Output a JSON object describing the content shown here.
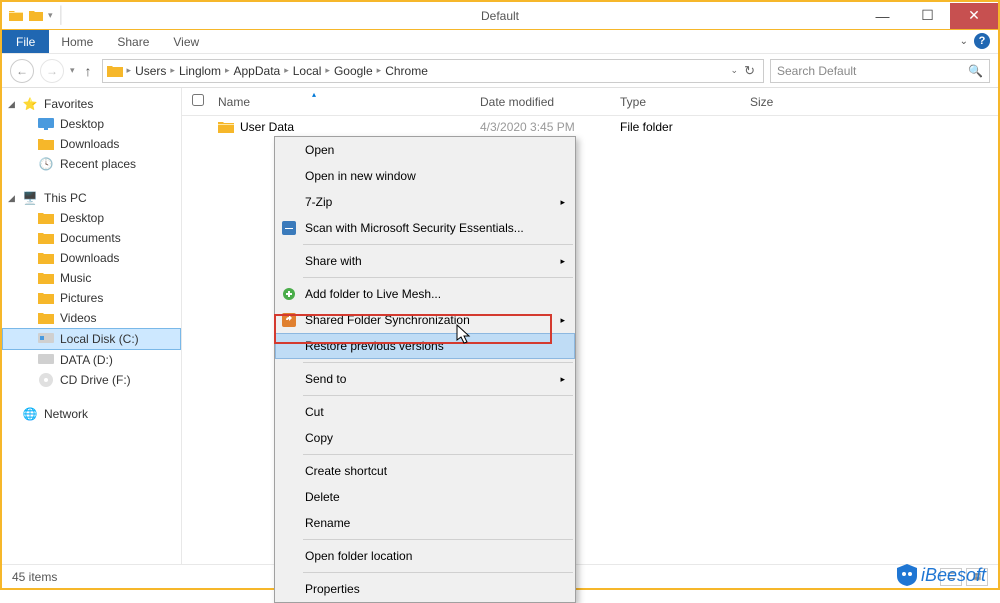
{
  "titlebar": {
    "title": "Default"
  },
  "window_controls": {
    "minimize": "—",
    "maximize": "☐",
    "close": "✕"
  },
  "ribbon": {
    "file": "File",
    "tabs": [
      "Home",
      "Share",
      "View"
    ]
  },
  "nav": {
    "back": "←",
    "forward": "→",
    "up": "↑"
  },
  "breadcrumb": [
    "Users",
    "Linglom",
    "AppData",
    "Local",
    "Google",
    "Chrome"
  ],
  "search": {
    "placeholder": "Search Default"
  },
  "sidebar": {
    "favorites": {
      "label": "Favorites",
      "items": [
        "Desktop",
        "Downloads",
        "Recent places"
      ]
    },
    "thispc": {
      "label": "This PC",
      "items": [
        "Desktop",
        "Documents",
        "Downloads",
        "Music",
        "Pictures",
        "Videos",
        "Local Disk (C:)",
        "DATA (D:)",
        "CD Drive (F:)"
      ]
    },
    "network": {
      "label": "Network"
    }
  },
  "columns": {
    "name": "Name",
    "date": "Date modified",
    "type": "Type",
    "size": "Size"
  },
  "files": [
    {
      "name": "User Data",
      "date": "4/3/2020 3:45 PM",
      "type": "File folder",
      "size": ""
    }
  ],
  "context_menu": {
    "items": [
      {
        "label": "Open",
        "submenu": false,
        "icon": ""
      },
      {
        "label": "Open in new window",
        "submenu": false,
        "icon": ""
      },
      {
        "label": "7-Zip",
        "submenu": true,
        "icon": ""
      },
      {
        "label": "Scan with Microsoft Security Essentials...",
        "submenu": false,
        "icon": "scan"
      },
      {
        "sep": true
      },
      {
        "label": "Share with",
        "submenu": true,
        "icon": ""
      },
      {
        "sep": true
      },
      {
        "label": "Add folder to Live Mesh...",
        "submenu": false,
        "icon": "mesh"
      },
      {
        "label": "Shared Folder Synchronization",
        "submenu": true,
        "icon": "sync"
      },
      {
        "label": "Restore previous versions",
        "submenu": false,
        "icon": "",
        "hover": true
      },
      {
        "sep": true
      },
      {
        "label": "Send to",
        "submenu": true,
        "icon": ""
      },
      {
        "sep": true
      },
      {
        "label": "Cut",
        "submenu": false,
        "icon": ""
      },
      {
        "label": "Copy",
        "submenu": false,
        "icon": ""
      },
      {
        "sep": true
      },
      {
        "label": "Create shortcut",
        "submenu": false,
        "icon": ""
      },
      {
        "label": "Delete",
        "submenu": false,
        "icon": ""
      },
      {
        "label": "Rename",
        "submenu": false,
        "icon": ""
      },
      {
        "sep": true
      },
      {
        "label": "Open folder location",
        "submenu": false,
        "icon": ""
      },
      {
        "sep": true
      },
      {
        "label": "Properties",
        "submenu": false,
        "icon": ""
      }
    ]
  },
  "statusbar": {
    "count": "45 items"
  },
  "watermark": "iBeesoft"
}
